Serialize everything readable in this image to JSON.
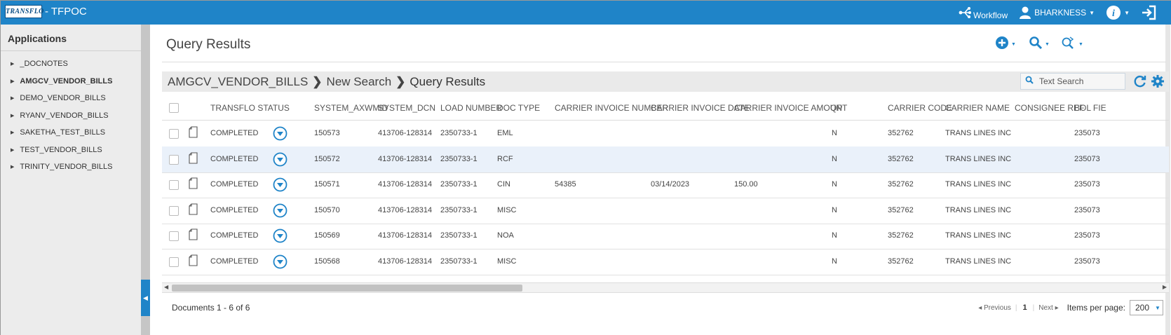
{
  "app": {
    "logo_text": "TRANSFLO",
    "title": "- TFPOC"
  },
  "topbar": {
    "workflow_label": "Workflow",
    "user_label": "BHARKNESS"
  },
  "sidebar": {
    "title": "Applications",
    "items": [
      {
        "label": "_DOCNOTES"
      },
      {
        "label": "AMGCV_VENDOR_BILLS"
      },
      {
        "label": "DEMO_VENDOR_BILLS"
      },
      {
        "label": "RYANV_VENDOR_BILLS"
      },
      {
        "label": "SAKETHA_TEST_BILLS"
      },
      {
        "label": "TEST_VENDOR_BILLS"
      },
      {
        "label": "TRINITY_VENDOR_BILLS"
      }
    ]
  },
  "main": {
    "page_title": "Query Results",
    "breadcrumb": [
      "AMGCV_VENDOR_BILLS",
      "New Search",
      "Query Results"
    ],
    "search_placeholder": "Text Search"
  },
  "grid": {
    "columns": {
      "status": "TRANSFLO STATUS",
      "axwmid": "SYSTEM_AXWMID",
      "dcn": "SYSTEM_DCN",
      "load": "LOAD NUMBER",
      "doctype": "DOC TYPE",
      "inv_num": "CARRIER INVOICE NUMBER",
      "inv_date": "CARRIER INVOICE DATE",
      "inv_amt": "CARRIER INVOICE AMOUNT",
      "qp": "QP",
      "carrier_code": "CARRIER CODE",
      "carrier_name": "CARRIER NAME",
      "consignee": "CONSIGNEE REF",
      "bol": "BOL FIE"
    },
    "rows": [
      {
        "status": "COMPLETED",
        "axwmid": "150573",
        "dcn": "413706-128314",
        "load": "2350733-1",
        "doctype": "EML",
        "inv_num": "",
        "inv_date": "",
        "inv_amt": "",
        "qp": "N",
        "carrier_code": "352762",
        "carrier_name": "TRANS LINES INC",
        "consignee": "",
        "bol": "235073"
      },
      {
        "status": "COMPLETED",
        "axwmid": "150572",
        "dcn": "413706-128314",
        "load": "2350733-1",
        "doctype": "RCF",
        "inv_num": "",
        "inv_date": "",
        "inv_amt": "",
        "qp": "N",
        "carrier_code": "352762",
        "carrier_name": "TRANS LINES INC",
        "consignee": "",
        "bol": "235073"
      },
      {
        "status": "COMPLETED",
        "axwmid": "150571",
        "dcn": "413706-128314",
        "load": "2350733-1",
        "doctype": "CIN",
        "inv_num": "54385",
        "inv_date": "03/14/2023",
        "inv_amt": "150.00",
        "qp": "N",
        "carrier_code": "352762",
        "carrier_name": "TRANS LINES INC",
        "consignee": "",
        "bol": "235073"
      },
      {
        "status": "COMPLETED",
        "axwmid": "150570",
        "dcn": "413706-128314",
        "load": "2350733-1",
        "doctype": "MISC",
        "inv_num": "",
        "inv_date": "",
        "inv_amt": "",
        "qp": "N",
        "carrier_code": "352762",
        "carrier_name": "TRANS LINES INC",
        "consignee": "",
        "bol": "235073"
      },
      {
        "status": "COMPLETED",
        "axwmid": "150569",
        "dcn": "413706-128314",
        "load": "2350733-1",
        "doctype": "NOA",
        "inv_num": "",
        "inv_date": "",
        "inv_amt": "",
        "qp": "N",
        "carrier_code": "352762",
        "carrier_name": "TRANS LINES INC",
        "consignee": "",
        "bol": "235073"
      },
      {
        "status": "COMPLETED",
        "axwmid": "150568",
        "dcn": "413706-128314",
        "load": "2350733-1",
        "doctype": "MISC",
        "inv_num": "",
        "inv_date": "",
        "inv_amt": "",
        "qp": "N",
        "carrier_code": "352762",
        "carrier_name": "TRANS LINES INC",
        "consignee": "",
        "bol": "235073"
      }
    ]
  },
  "footer": {
    "documents_count": "Documents 1 - 6 of 6",
    "prev_label": "◂ Previous",
    "page_number": "1",
    "next_label": "Next ▸",
    "items_per_page_label": "Items per page:",
    "items_per_page_value": "200"
  },
  "icons": {
    "workflow": "workflow-icon",
    "user": "user-icon",
    "info": "info-icon",
    "logout": "logout-icon",
    "add": "add-icon",
    "search": "search-icon",
    "advanced_search": "advanced-search-icon",
    "refresh": "refresh-icon",
    "settings": "gear-icon",
    "document": "document-icon",
    "download": "download-icon"
  },
  "colors": {
    "accent": "#1f84c8",
    "row_hover": "#eaf1fa"
  }
}
